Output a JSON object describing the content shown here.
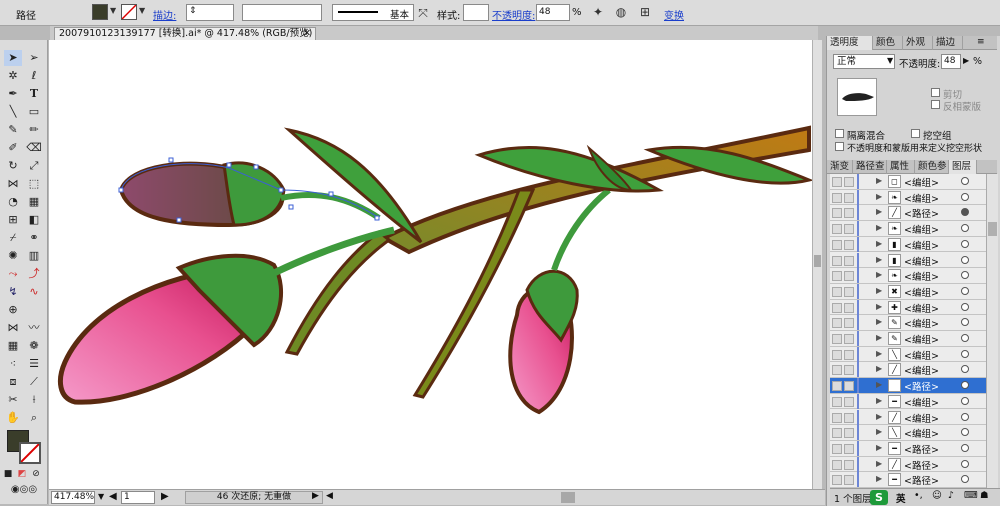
{
  "control_bar": {
    "selection_type": "路径",
    "stroke_label": "描边:",
    "stroke_value": "",
    "brush_label": "基本",
    "style_label": "样式:",
    "opacity_label": "不透明度:",
    "opacity_value": "48",
    "opacity_unit": "%",
    "transform_label": "变换",
    "fill_color": "#3a3d2a"
  },
  "document_tab": {
    "title": "2007910123139177  [转换].ai* @ 417.48% (RGB/预览)",
    "close_glyph": "✕"
  },
  "status_bar": {
    "zoom": "417.48%",
    "artboard": "1",
    "history": "46 次还原; 无重做"
  },
  "transparency_panel": {
    "tabs": [
      "透明度",
      "颜色",
      "外观",
      "描边"
    ],
    "blend_mode": "正常",
    "opacity_label": "不透明度:",
    "opacity_value": "48",
    "opacity_unit": "%",
    "clip_label": "剪切",
    "invert_mask_label": "反相蒙版",
    "isolate_blend_label": "隔离混合",
    "knockout_group_label": "挖空组",
    "opacity_mask_label": "不透明度和蒙版用来定义挖空形状"
  },
  "layers_panel": {
    "tabs": [
      "渐变",
      "路径查",
      "属性",
      "颜色参",
      "图层"
    ],
    "rows": [
      {
        "name": "<编组>",
        "thumb": "◻",
        "target": "hollow",
        "selected": false
      },
      {
        "name": "<编组>",
        "thumb": "❧",
        "target": "hollow",
        "selected": false
      },
      {
        "name": "<路径>",
        "thumb": "╱",
        "target": "full",
        "selected": false
      },
      {
        "name": "<编组>",
        "thumb": "❧",
        "target": "hollow",
        "selected": false
      },
      {
        "name": "<编组>",
        "thumb": "▮",
        "target": "hollow",
        "selected": false
      },
      {
        "name": "<编组>",
        "thumb": "▮",
        "target": "hollow",
        "selected": false
      },
      {
        "name": "<编组>",
        "thumb": "❧",
        "target": "hollow",
        "selected": false
      },
      {
        "name": "<编组>",
        "thumb": "✖",
        "target": "hollow",
        "selected": false
      },
      {
        "name": "<编组>",
        "thumb": "✚",
        "target": "hollow",
        "selected": false
      },
      {
        "name": "<编组>",
        "thumb": "✎",
        "target": "hollow",
        "selected": false
      },
      {
        "name": "<编组>",
        "thumb": "✎",
        "target": "hollow",
        "selected": false
      },
      {
        "name": "<编组>",
        "thumb": "╲",
        "target": "hollow",
        "selected": false
      },
      {
        "name": "<编组>",
        "thumb": "╱",
        "target": "hollow",
        "selected": false
      },
      {
        "name": "<路径>",
        "thumb": "━",
        "target": "hollow",
        "selected": true
      },
      {
        "name": "<编组>",
        "thumb": "━",
        "target": "hollow",
        "selected": false
      },
      {
        "name": "<编组>",
        "thumb": "╱",
        "target": "hollow",
        "selected": false
      },
      {
        "name": "<编组>",
        "thumb": "╲",
        "target": "hollow",
        "selected": false
      },
      {
        "name": "<路径>",
        "thumb": "━",
        "target": "hollow",
        "selected": false
      },
      {
        "name": "<路径>",
        "thumb": "╱",
        "target": "hollow",
        "selected": false
      },
      {
        "name": "<路径>",
        "thumb": "━",
        "target": "hollow",
        "selected": false
      }
    ],
    "footer_label": "1 个图层"
  },
  "watermark": {
    "ime_label": "英"
  }
}
